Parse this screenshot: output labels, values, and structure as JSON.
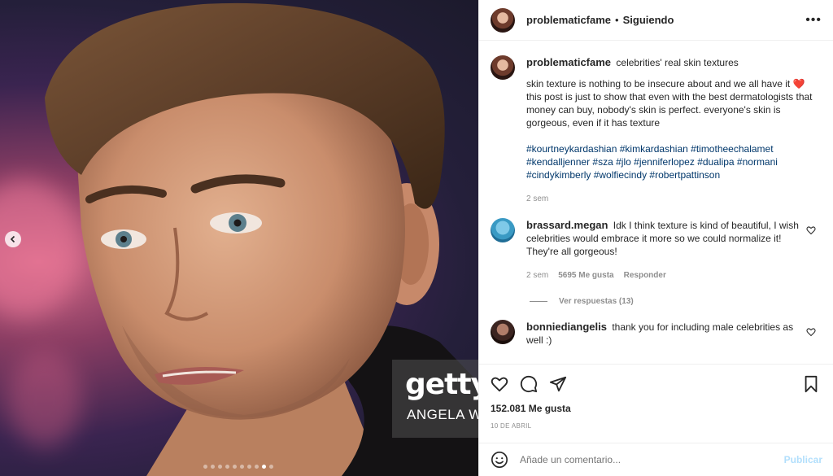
{
  "post": {
    "username": "problematicfame",
    "separator": "•",
    "follow_label": "Siguiendo",
    "more_label": "•••",
    "carousel": {
      "total_slides": 10,
      "active_slide": 9
    }
  },
  "watermark": {
    "brand": "gettyi",
    "credit": "ANGELA W"
  },
  "caption": {
    "username": "problematicfame",
    "title": "celebrities' real skin textures",
    "text_line": "skin texture is nothing to be insecure about and we all have it ❤️ this post is just to show that even with the best dermatologists that money can buy, nobody's skin is perfect. everyone's skin is gorgeous, even if it has texture",
    "hashtags": [
      "#kourtneykardashian",
      "#kimkardashian",
      "#timotheechalamet",
      "#kendalljenner",
      "#sza",
      "#jlo",
      "#jenniferlopez",
      "#dualipa",
      "#normani",
      "#cindykimberly",
      "#wolfiecindy",
      "#robertpattinson"
    ],
    "time": "2 sem"
  },
  "comments": [
    {
      "username": "brassard.megan",
      "text": "Idk I think texture is kind of beautiful, I wish celebrities would embrace it more so we could normalize it! They're all gorgeous!",
      "time": "2 sem",
      "likes": "5695 Me gusta",
      "reply_label": "Responder",
      "view_replies": "Ver respuestas (13)"
    },
    {
      "username": "bonniediangelis",
      "text": "thank you for including male celebrities as well :)"
    }
  ],
  "stats": {
    "likes": "152.081 Me gusta",
    "date": "10 DE ABRIL"
  },
  "add_comment": {
    "placeholder": "Añade un comentario...",
    "publish_label": "Publicar"
  },
  "colors": {
    "link": "#00376b",
    "heart": "#ed4956",
    "muted": "#8e8e8e",
    "publish_disabled": "#b2dffc"
  }
}
